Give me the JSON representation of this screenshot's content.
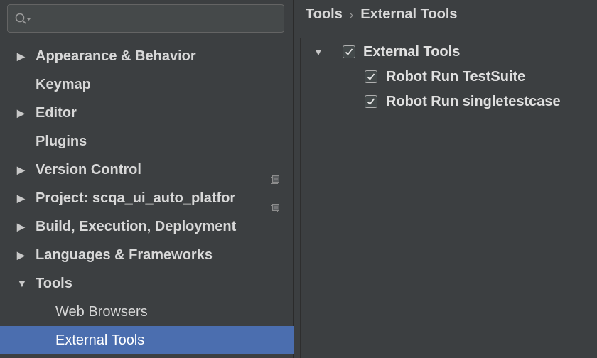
{
  "search": {
    "placeholder": ""
  },
  "sidebar": {
    "items": [
      {
        "label": "Appearance & Behavior",
        "expandable": true,
        "expanded": false
      },
      {
        "label": "Keymap",
        "expandable": false
      },
      {
        "label": "Editor",
        "expandable": true,
        "expanded": false
      },
      {
        "label": "Plugins",
        "expandable": false
      },
      {
        "label": "Version Control",
        "expandable": true,
        "expanded": false,
        "project_icon": true
      },
      {
        "label": "Project: scqa_ui_auto_platfor",
        "expandable": true,
        "expanded": false,
        "project_icon": true
      },
      {
        "label": "Build, Execution, Deployment",
        "expandable": true,
        "expanded": false
      },
      {
        "label": "Languages & Frameworks",
        "expandable": true,
        "expanded": false
      },
      {
        "label": "Tools",
        "expandable": true,
        "expanded": true
      },
      {
        "label": "Web Browsers",
        "child": true
      },
      {
        "label": "External Tools",
        "child": true,
        "selected": true
      }
    ]
  },
  "breadcrumb": {
    "parent": "Tools",
    "separator": "›",
    "current": "External Tools"
  },
  "tree": {
    "group": {
      "label": "External Tools",
      "checked": true,
      "expanded": true
    },
    "tools": [
      {
        "label": "Robot Run TestSuite",
        "checked": true
      },
      {
        "label": "Robot Run singletestcase",
        "checked": true
      }
    ]
  },
  "colors": {
    "background": "#3c3f41",
    "selection": "#4b6eaf",
    "text": "#d8d8d8"
  },
  "icons": {
    "search": "search-icon",
    "expand_collapsed": "triangle-right-icon",
    "expand_expanded": "triangle-down-icon",
    "project_scope": "project-scope-icon",
    "checkbox": "checkbox-checked-icon"
  }
}
